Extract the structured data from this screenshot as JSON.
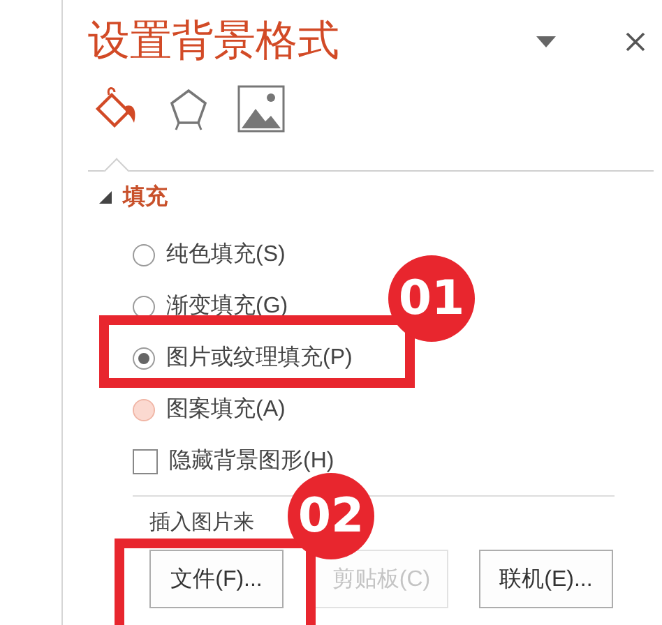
{
  "pane": {
    "title": "设置背景格式"
  },
  "tabs": [
    {
      "kind": "fill",
      "selected": true
    },
    {
      "kind": "effects",
      "selected": false
    },
    {
      "kind": "picture",
      "selected": false
    }
  ],
  "section": {
    "title": "填充",
    "expanded": true
  },
  "fill_options": [
    {
      "label": "纯色填充(S)",
      "selected": false,
      "hover": false
    },
    {
      "label": "渐变填充(G)",
      "selected": false,
      "hover": false
    },
    {
      "label": "图片或纹理填充(P)",
      "selected": true,
      "hover": false
    },
    {
      "label": "图案填充(A)",
      "selected": false,
      "hover": true
    }
  ],
  "hide_background": {
    "label": "隐藏背景图形(H)",
    "checked": false
  },
  "insert_label": "插入图片来",
  "buttons": [
    {
      "label": "文件(F)...",
      "disabled": false
    },
    {
      "label": "剪贴板(C)",
      "disabled": true
    },
    {
      "label": "联机(E)...",
      "disabled": false
    }
  ],
  "annotations": [
    {
      "number": "01"
    },
    {
      "number": "02"
    }
  ]
}
